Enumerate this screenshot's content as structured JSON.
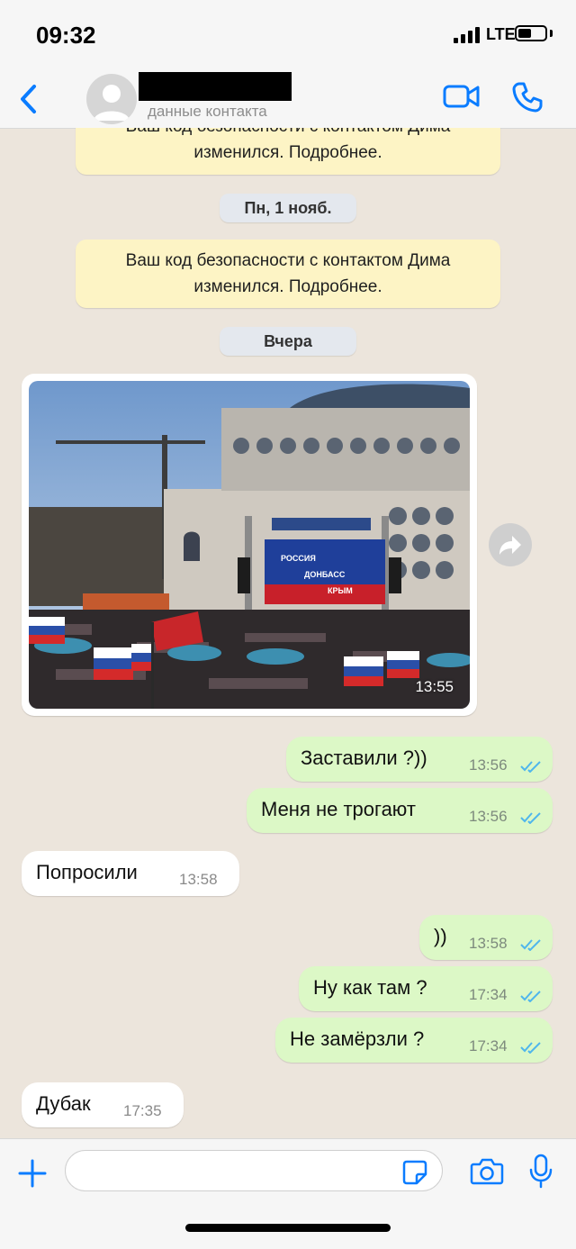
{
  "status_bar": {
    "time": "09:32",
    "network": "LTE",
    "battery_level": 0.5
  },
  "header": {
    "contact_subtitle": "данные контакта"
  },
  "chat": {
    "system_notice_1": "Ваш код безопасности с контактом Дима изменился. Подробнее.",
    "date_1": "Пн, 1 нояб.",
    "system_notice_2": "Ваш код безопасности с контактом Дима изменился. Подробнее.",
    "date_2": "Вчера",
    "photo": {
      "time": "13:55",
      "sign_lines": [
        "РОССИЯ",
        "ДОНБАСС",
        "КРЫМ"
      ]
    },
    "messages": [
      {
        "direction": "out",
        "text": "Заставили ?))",
        "time": "13:56",
        "read": true
      },
      {
        "direction": "out",
        "text": "Меня не трогают",
        "time": "13:56",
        "read": true
      },
      {
        "direction": "in",
        "text": "Попросили",
        "time": "13:58"
      },
      {
        "direction": "out",
        "text": "))",
        "time": "13:58",
        "read": true
      },
      {
        "direction": "out",
        "text": "Ну как там ?",
        "time": "17:34",
        "read": true
      },
      {
        "direction": "out",
        "text": "Не замёрзли ?",
        "time": "17:34",
        "read": true
      },
      {
        "direction": "in",
        "text": "Дубак",
        "time": "17:35"
      }
    ]
  },
  "input_bar": {
    "message_value": "",
    "placeholder": ""
  },
  "colors": {
    "accent": "#0a7cff",
    "outgoing_bubble": "#dcf8c6",
    "incoming_bubble": "#ffffff",
    "system_notice": "#fdf4c5",
    "read_check": "#4fb6ec"
  }
}
